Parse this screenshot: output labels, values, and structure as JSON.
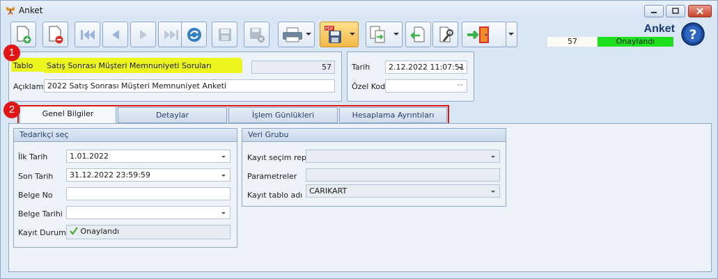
{
  "window": {
    "title": "Anket"
  },
  "header": {
    "title": "Anket",
    "record_count": "57",
    "status": "Onaylandı",
    "status_color": "#1fe01f"
  },
  "toolbar": {
    "icons": [
      "new-doc-icon",
      "delete-doc-icon",
      "first-record-icon",
      "previous-record-icon",
      "next-record-icon",
      "last-record-icon",
      "refresh-icon",
      "save-icon",
      "cancel-save-icon",
      "print-icon",
      "pdf-export-icon",
      "export-icon",
      "import-icon",
      "settings-icon",
      "exit-icon",
      "help-icon"
    ]
  },
  "badges": {
    "one": "1",
    "two": "2"
  },
  "top_form": {
    "tablo_label": "Tablo",
    "tablo_value": "Satış Sonrası Müşteri Memnuniyeti Soruları",
    "tablo_count": "57",
    "aciklama_label": "Açıklama",
    "aciklama_value": "2022 Satış Sonrası Müşteri Memnuniyet Anketi",
    "tarih_label": "Tarih",
    "tarih_value": "2.12.2022 11:07:51",
    "ozel_kod_label": "Özel Kod",
    "ozel_kod_value": "",
    "ellipsis": "···"
  },
  "tabs": [
    {
      "label": "Genel Bilgiler",
      "active": true
    },
    {
      "label": "Detaylar",
      "active": false
    },
    {
      "label": "İşlem Günlükleri",
      "active": false
    },
    {
      "label": "Hesaplama Ayrıntıları",
      "active": false
    }
  ],
  "tedarikci": {
    "header": "Tedarikçi seç",
    "ilk_tarih_label": "İlk Tarih",
    "ilk_tarih_value": "1.01.2022",
    "son_tarih_label": "Son Tarih",
    "son_tarih_value": "31.12.2022 23:59:59",
    "belge_no_label": "Belge No",
    "belge_no_value": "",
    "belge_tarihi_label": "Belge Tarihi",
    "belge_tarihi_value": "",
    "kayit_durumu_label": "Kayıt Durumu",
    "kayit_durumu_value": "Onaylandı"
  },
  "veri_grubu": {
    "header": "Veri Grubu",
    "kayit_secim_label": "Kayıt seçim repo",
    "kayit_secim_value": "",
    "parametreler_label": "Parametreler",
    "parametreler_value": "",
    "kayit_tablo_label": "Kayıt tablo adı",
    "kayit_tablo_value": "CARIKART"
  }
}
